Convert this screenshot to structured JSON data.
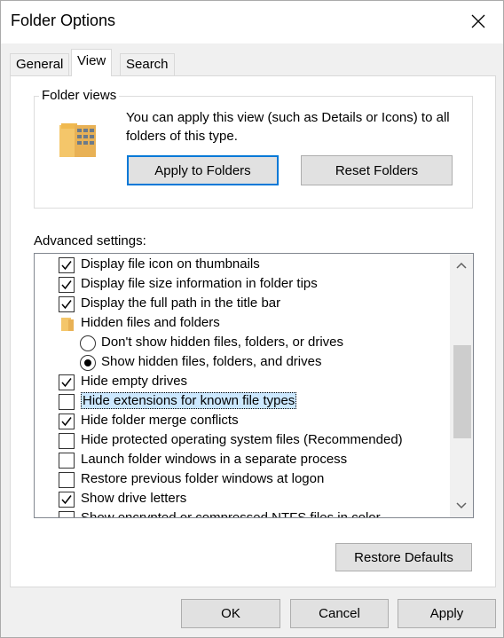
{
  "window": {
    "title": "Folder Options"
  },
  "tabs": [
    {
      "label": "General",
      "active": false
    },
    {
      "label": "View",
      "active": true
    },
    {
      "label": "Search",
      "active": false
    }
  ],
  "folder_views": {
    "legend": "Folder views",
    "description": "You can apply this view (such as Details or Icons) to all folders of this type.",
    "apply_button": "Apply to Folders",
    "reset_button": "Reset Folders"
  },
  "advanced": {
    "label": "Advanced settings:",
    "items": [
      {
        "type": "checkbox",
        "checked": true,
        "label": "Display file icon on thumbnails"
      },
      {
        "type": "checkbox",
        "checked": true,
        "label": "Display file size information in folder tips"
      },
      {
        "type": "checkbox",
        "checked": true,
        "label": "Display the full path in the title bar"
      },
      {
        "type": "folder",
        "label": "Hidden files and folders"
      },
      {
        "type": "radio",
        "checked": false,
        "label": "Don't show hidden files, folders, or drives"
      },
      {
        "type": "radio",
        "checked": true,
        "label": "Show hidden files, folders, and drives"
      },
      {
        "type": "checkbox",
        "checked": true,
        "label": "Hide empty drives"
      },
      {
        "type": "checkbox",
        "checked": false,
        "label": "Hide extensions for known file types",
        "selected": true
      },
      {
        "type": "checkbox",
        "checked": true,
        "label": "Hide folder merge conflicts"
      },
      {
        "type": "checkbox",
        "checked": false,
        "label": "Hide protected operating system files (Recommended)"
      },
      {
        "type": "checkbox",
        "checked": false,
        "label": "Launch folder windows in a separate process"
      },
      {
        "type": "checkbox",
        "checked": false,
        "label": "Restore previous folder windows at logon"
      },
      {
        "type": "checkbox",
        "checked": true,
        "label": "Show drive letters"
      },
      {
        "type": "checkbox",
        "checked": false,
        "label": "Show encrypted or compressed NTFS files in color"
      }
    ],
    "scroll_position": 0.55,
    "restore_defaults_button": "Restore Defaults"
  },
  "footer": {
    "ok_button": "OK",
    "cancel_button": "Cancel",
    "apply_button": "Apply"
  },
  "colors": {
    "accent": "#0078d7",
    "selection_bg": "#cce8ff",
    "folder_yellow": "#f4c66a"
  },
  "icons": {
    "close": "close-icon",
    "folder_views": "folder-views-icon",
    "folder": "folder-icon",
    "check": "check-icon",
    "scroll_up": "chevron-up-icon",
    "scroll_down": "chevron-down-icon"
  }
}
